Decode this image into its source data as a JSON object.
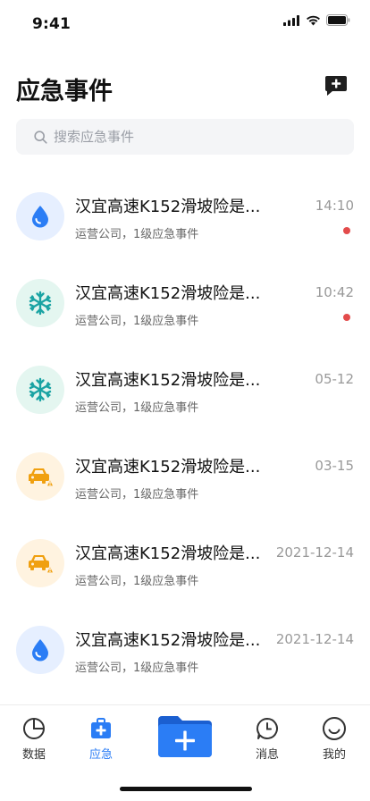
{
  "status": {
    "time": "9:41"
  },
  "header": {
    "title": "应急事件"
  },
  "search": {
    "placeholder": "搜索应急事件"
  },
  "events": [
    {
      "title": "汉宜高速K152滑坡险是...",
      "subtitle": "运营公司，1级应急事件",
      "time": "14:10",
      "icon": "water-drop-icon",
      "unread": true
    },
    {
      "title": "汉宜高速K152滑坡险是...",
      "subtitle": "运营公司，1级应急事件",
      "time": "10:42",
      "icon": "snowflake-icon",
      "unread": true
    },
    {
      "title": "汉宜高速K152滑坡险是...",
      "subtitle": "运营公司，1级应急事件",
      "time": "05-12",
      "icon": "snowflake-icon",
      "unread": false
    },
    {
      "title": "汉宜高速K152滑坡险是...",
      "subtitle": "运营公司，1级应急事件",
      "time": "03-15",
      "icon": "car-accident-icon",
      "unread": false
    },
    {
      "title": "汉宜高速K152滑坡险是...",
      "subtitle": "运营公司，1级应急事件",
      "time": "2021-12-14",
      "icon": "car-accident-icon",
      "unread": false
    },
    {
      "title": "汉宜高速K152滑坡险是...",
      "subtitle": "运营公司，1级应急事件",
      "time": "2021-12-14",
      "icon": "water-drop-icon",
      "unread": false
    }
  ],
  "tabbar": {
    "data_label": "数据",
    "emergency_label": "应急",
    "messages_label": "消息",
    "mine_label": "我的"
  },
  "colors": {
    "accent": "#2b7df5",
    "unread": "#e34b4b",
    "water": "#2b7df5",
    "snow": "#1aa3a3",
    "accident": "#f0a010"
  }
}
